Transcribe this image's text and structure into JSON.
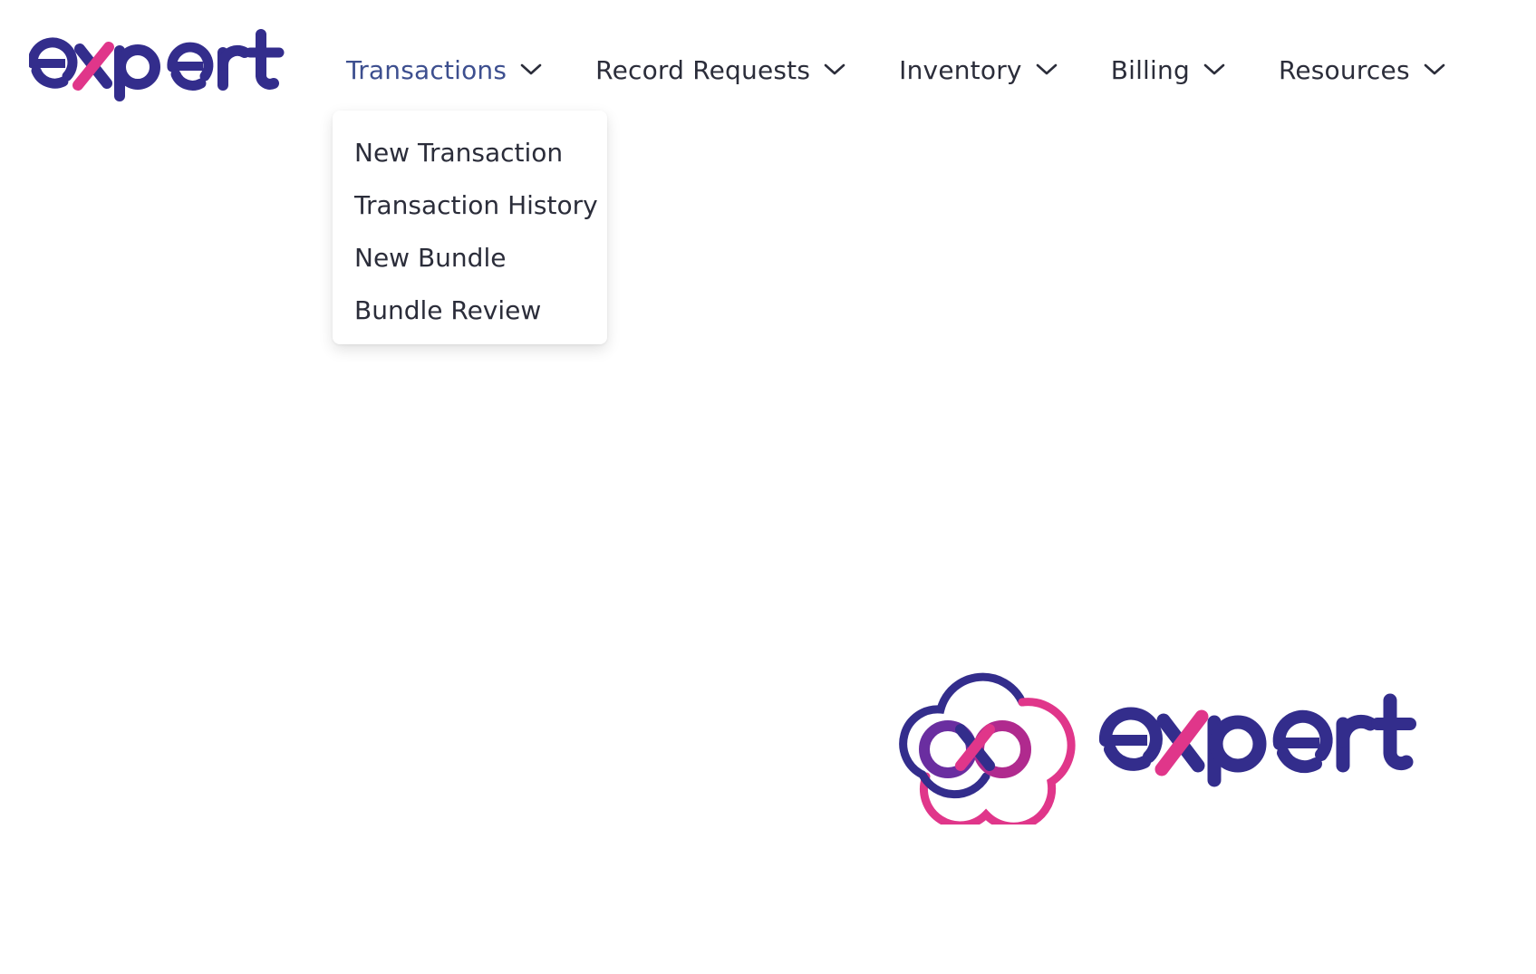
{
  "brand": {
    "name": "expert",
    "primary_color": "#332d8c",
    "accent_color": "#e0368a"
  },
  "nav": {
    "items": [
      {
        "label": "Transactions",
        "active": true
      },
      {
        "label": "Record Requests",
        "active": false
      },
      {
        "label": "Inventory",
        "active": false
      },
      {
        "label": "Billing",
        "active": false
      },
      {
        "label": "Resources",
        "active": false
      }
    ],
    "chevron_icon": "chevron-down-icon"
  },
  "dropdown": {
    "parent": "Transactions",
    "items": [
      {
        "label": "New Transaction"
      },
      {
        "label": "Transaction History"
      },
      {
        "label": "New Bundle"
      },
      {
        "label": "Bundle Review"
      }
    ]
  },
  "colors": {
    "nav_text": "#2b2d3a",
    "nav_active": "#3d4f8f"
  }
}
